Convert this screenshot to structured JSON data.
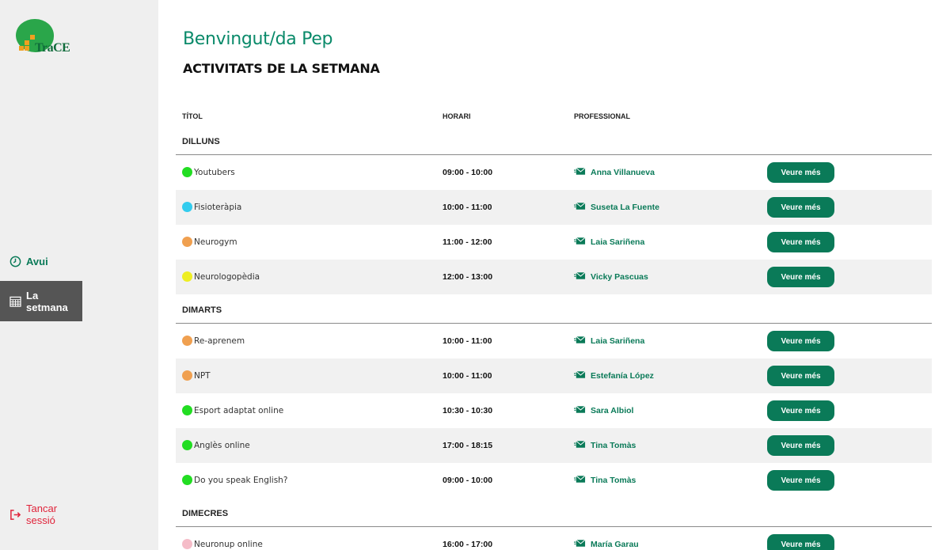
{
  "app": {
    "logo_text": "TraCE"
  },
  "sidebar": {
    "today_label": "Avui",
    "week_label": "La setmana",
    "logout_label": "Tancar sessió"
  },
  "header": {
    "welcome": "Benvingut/da Pep",
    "section_title": "ACTIVITATS DE LA SETMANA"
  },
  "table": {
    "columns": {
      "title": "TÍTOL",
      "time": "HORARI",
      "professional": "PROFESSIONAL"
    },
    "button_label": "Veure més",
    "days": [
      {
        "name": "DILLUNS",
        "rows": [
          {
            "title": "Youtubers",
            "time": "09:00 - 10:00",
            "professional": "Anna Villanueva",
            "color": "#22dd22"
          },
          {
            "title": "Fisioteràpia",
            "time": "10:00 - 11:00",
            "professional": "Suseta La Fuente",
            "color": "#33ccee"
          },
          {
            "title": "Neurogym",
            "time": "11:00 - 12:00",
            "professional": "Laia Sariñena",
            "color": "#f0a050"
          },
          {
            "title": "Neurologopèdia",
            "time": "12:00 - 13:00",
            "professional": "Vicky Pascuas",
            "color": "#eeee22"
          }
        ]
      },
      {
        "name": "DIMARTS",
        "rows": [
          {
            "title": "Re-aprenem",
            "time": "10:00 - 11:00",
            "professional": "Laia Sariñena",
            "color": "#f0a050"
          },
          {
            "title": "NPT",
            "time": "10:00 - 11:00",
            "professional": "Estefanía López",
            "color": "#f0a050"
          },
          {
            "title": "Esport adaptat online",
            "time": "10:30 - 10:30",
            "professional": "Sara Albiol",
            "color": "#22dd22"
          },
          {
            "title": "Anglès online",
            "time": "17:00 - 18:15",
            "professional": "Tina Tomàs",
            "color": "#22dd22"
          },
          {
            "title": "Do you speak English?",
            "time": "09:00 - 10:00",
            "professional": "Tina Tomàs",
            "color": "#22dd22"
          }
        ]
      },
      {
        "name": "DIMECRES",
        "rows": [
          {
            "title": "Neuronup online",
            "time": "16:00 - 17:00",
            "professional": "María Garau",
            "color": "#f5bcc8"
          }
        ]
      }
    ]
  },
  "colors": {
    "accent": "#0a7a58",
    "logout": "#e0233a",
    "sidebar_bg": "#efefef",
    "active_nav": "#555555"
  },
  "icons": {
    "today": "clock-icon",
    "week": "calendar-icon",
    "logout": "logout-icon",
    "mail": "mail-icon"
  }
}
